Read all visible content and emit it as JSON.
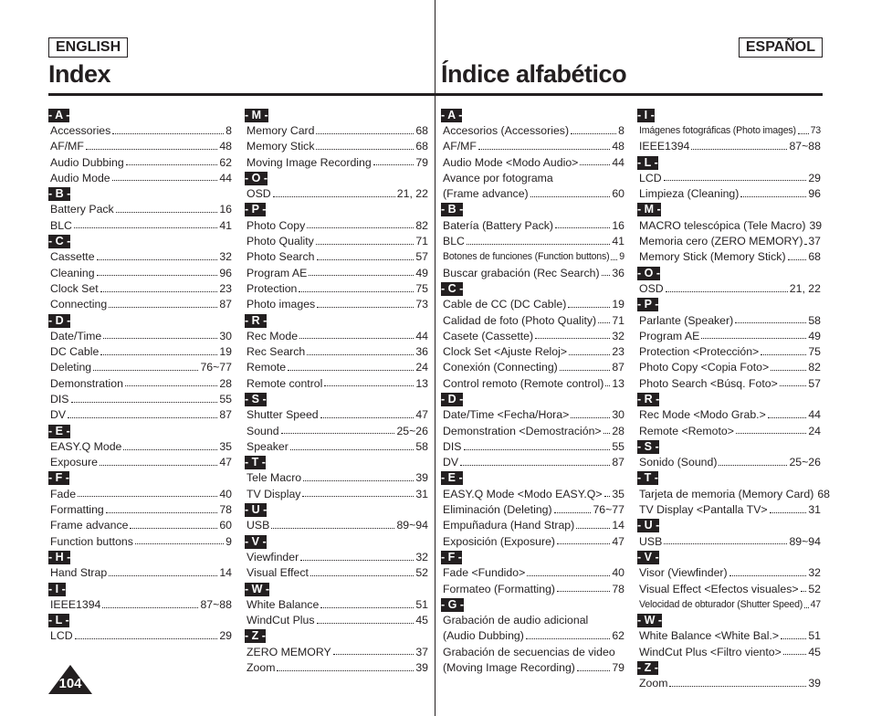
{
  "header": {
    "english_label": "ENGLISH",
    "spanish_label": "ESPAÑOL",
    "english_title": "Index",
    "spanish_title": "Índice alfabético"
  },
  "page_number": "104",
  "columns": [
    [
      {
        "letter": "- A -",
        "items": [
          {
            "label": "Accessories",
            "page": "8"
          },
          {
            "label": "AF/MF",
            "page": "48"
          },
          {
            "label": "Audio Dubbing",
            "page": "62"
          },
          {
            "label": "Audio Mode",
            "page": "44"
          }
        ]
      },
      {
        "letter": "- B -",
        "items": [
          {
            "label": "Battery Pack",
            "page": "16"
          },
          {
            "label": "BLC",
            "page": "41"
          }
        ]
      },
      {
        "letter": "- C -",
        "items": [
          {
            "label": "Cassette",
            "page": "32"
          },
          {
            "label": "Cleaning",
            "page": "96"
          },
          {
            "label": "Clock Set",
            "page": "23"
          },
          {
            "label": "Connecting",
            "page": "87"
          }
        ]
      },
      {
        "letter": "- D -",
        "items": [
          {
            "label": "Date/Time",
            "page": "30"
          },
          {
            "label": "DC Cable",
            "page": "19"
          },
          {
            "label": "Deleting",
            "page": "76~77"
          },
          {
            "label": "Demonstration",
            "page": "28"
          },
          {
            "label": "DIS",
            "page": "55"
          },
          {
            "label": "DV",
            "page": "87"
          }
        ]
      },
      {
        "letter": "- E -",
        "items": [
          {
            "label": "EASY.Q Mode",
            "page": "35"
          },
          {
            "label": "Exposure",
            "page": "47"
          }
        ]
      },
      {
        "letter": "- F -",
        "items": [
          {
            "label": "Fade",
            "page": "40"
          },
          {
            "label": "Formatting",
            "page": "78"
          },
          {
            "label": "Frame advance",
            "page": "60"
          },
          {
            "label": "Function buttons",
            "page": "9"
          }
        ]
      },
      {
        "letter": "- H -",
        "items": [
          {
            "label": "Hand Strap",
            "page": "14"
          }
        ]
      },
      {
        "letter": "- I -",
        "items": [
          {
            "label": "IEEE1394",
            "page": "87~88"
          }
        ]
      },
      {
        "letter": "- L -",
        "items": [
          {
            "label": "LCD",
            "page": "29"
          }
        ]
      }
    ],
    [
      {
        "letter": "- M -",
        "items": [
          {
            "label": "Memory Card",
            "page": "68"
          },
          {
            "label": "Memory Stick",
            "page": "68"
          },
          {
            "label": "Moving Image Recording",
            "page": "79"
          }
        ]
      },
      {
        "letter": "- O -",
        "items": [
          {
            "label": "OSD",
            "page": "21, 22"
          }
        ]
      },
      {
        "letter": "- P -",
        "items": [
          {
            "label": "Photo Copy",
            "page": "82"
          },
          {
            "label": "Photo Quality",
            "page": "71"
          },
          {
            "label": "Photo Search",
            "page": "57"
          },
          {
            "label": "Program AE",
            "page": "49"
          },
          {
            "label": "Protection",
            "page": "75"
          },
          {
            "label": "Photo images",
            "page": "73"
          }
        ]
      },
      {
        "letter": "- R -",
        "items": [
          {
            "label": "Rec Mode",
            "page": "44"
          },
          {
            "label": "Rec Search",
            "page": "36"
          },
          {
            "label": "Remote",
            "page": "24"
          },
          {
            "label": "Remote control",
            "page": "13"
          }
        ]
      },
      {
        "letter": "- S -",
        "items": [
          {
            "label": "Shutter Speed",
            "page": "47"
          },
          {
            "label": "Sound",
            "page": "25~26"
          },
          {
            "label": "Speaker",
            "page": "58"
          }
        ]
      },
      {
        "letter": "- T -",
        "items": [
          {
            "label": "Tele Macro",
            "page": "39"
          },
          {
            "label": "TV Display",
            "page": "31"
          }
        ]
      },
      {
        "letter": "- U -",
        "items": [
          {
            "label": "USB",
            "page": "89~94"
          }
        ]
      },
      {
        "letter": "- V -",
        "items": [
          {
            "label": "Viewfinder",
            "page": "32"
          },
          {
            "label": "Visual Effect",
            "page": "52"
          }
        ]
      },
      {
        "letter": "- W -",
        "items": [
          {
            "label": "White Balance",
            "page": "51"
          },
          {
            "label": "WindCut Plus",
            "page": "45"
          }
        ]
      },
      {
        "letter": "- Z -",
        "items": [
          {
            "label": "ZERO MEMORY",
            "page": "37"
          },
          {
            "label": "Zoom",
            "page": "39"
          }
        ]
      }
    ],
    [
      {
        "letter": "- A -",
        "items": [
          {
            "label": "Accesorios (Accessories)",
            "page": "8"
          },
          {
            "label": "AF/MF",
            "page": "48"
          },
          {
            "label": "Audio Mode <Modo Audio>",
            "page": "44"
          },
          {
            "pre": "Avance por fotograma",
            "label": "(Frame advance)",
            "page": "60"
          }
        ]
      },
      {
        "letter": "- B -",
        "items": [
          {
            "label": "Batería (Battery Pack)",
            "page": "16"
          },
          {
            "label": "BLC",
            "page": "41"
          },
          {
            "label": "Botones de funciones (Function buttons)",
            "page": "9"
          },
          {
            "label": "Buscar grabación (Rec Search)",
            "page": "36"
          }
        ]
      },
      {
        "letter": "- C -",
        "items": [
          {
            "label": "Cable de CC (DC Cable)",
            "page": "19"
          },
          {
            "label": "Calidad de foto (Photo Quality)",
            "page": "71"
          },
          {
            "label": "Casete (Cassette)",
            "page": "32"
          },
          {
            "label": "Clock Set <Ajuste Reloj>",
            "page": "23"
          },
          {
            "label": "Conexión (Connecting)",
            "page": "87"
          },
          {
            "label": "Control remoto (Remote control)",
            "page": "13"
          }
        ]
      },
      {
        "letter": "- D -",
        "items": [
          {
            "label": "Date/Time <Fecha/Hora>",
            "page": "30"
          },
          {
            "label": "Demonstration <Demostración>",
            "page": "28"
          },
          {
            "label": "DIS",
            "page": "55"
          },
          {
            "label": "DV",
            "page": "87"
          }
        ]
      },
      {
        "letter": "- E -",
        "items": [
          {
            "label": "EASY.Q Mode <Modo EASY.Q>",
            "page": "35"
          },
          {
            "label": "Eliminación (Deleting)",
            "page": "76~77"
          },
          {
            "label": "Empuñadura (Hand Strap)",
            "page": "14"
          },
          {
            "label": "Exposición (Exposure)",
            "page": "47"
          }
        ]
      },
      {
        "letter": "- F -",
        "items": [
          {
            "label": "Fade <Fundido>",
            "page": "40"
          },
          {
            "label": "Formateo (Formatting)",
            "page": "78"
          }
        ]
      },
      {
        "letter": "- G -",
        "items": [
          {
            "pre": "Grabación de audio adicional",
            "label": "(Audio Dubbing)",
            "page": "62"
          },
          {
            "pre": "Grabación de secuencias de video",
            "label": "(Moving Image Recording)",
            "page": "79"
          }
        ]
      }
    ],
    [
      {
        "letter": "- I -",
        "items": [
          {
            "label": "Imágenes fotográficas (Photo images)",
            "page": "73"
          },
          {
            "label": "IEEE1394",
            "page": "87~88"
          }
        ]
      },
      {
        "letter": "- L -",
        "items": [
          {
            "label": "LCD",
            "page": "29"
          },
          {
            "label": "Limpieza (Cleaning)",
            "page": "96"
          }
        ]
      },
      {
        "letter": "- M -",
        "items": [
          {
            "label": "MACRO telescópica (Tele Macro)",
            "page": "39"
          },
          {
            "label": "Memoria cero (ZERO MEMORY)",
            "page": "37"
          },
          {
            "label": "Memory Stick (Memory Stick)",
            "page": "68"
          }
        ]
      },
      {
        "letter": "- O -",
        "items": [
          {
            "label": "OSD",
            "page": "21, 22"
          }
        ]
      },
      {
        "letter": "- P -",
        "items": [
          {
            "label": "Parlante (Speaker)",
            "page": "58"
          },
          {
            "label": "Program AE",
            "page": "49"
          },
          {
            "label": "Protection <Protección>",
            "page": "75"
          },
          {
            "label": "Photo Copy <Copia Foto>",
            "page": "82"
          },
          {
            "label": "Photo Search <Búsq. Foto>",
            "page": "57"
          }
        ]
      },
      {
        "letter": "- R -",
        "items": [
          {
            "label": "Rec Mode <Modo Grab.>",
            "page": "44"
          },
          {
            "label": "Remote <Remoto>",
            "page": "24"
          }
        ]
      },
      {
        "letter": "- S -",
        "items": [
          {
            "label": "Sonido (Sound)",
            "page": "25~26"
          }
        ]
      },
      {
        "letter": "- T -",
        "items": [
          {
            "label": "Tarjeta de memoria (Memory Card)",
            "page": "68"
          },
          {
            "label": "TV Display <Pantalla TV>",
            "page": "31"
          }
        ]
      },
      {
        "letter": "- U -",
        "items": [
          {
            "label": "USB",
            "page": "89~94"
          }
        ]
      },
      {
        "letter": "- V -",
        "items": [
          {
            "label": "Visor (Viewfinder)",
            "page": "32"
          },
          {
            "label": "Visual Effect <Efectos visuales>",
            "page": "52"
          },
          {
            "label": "Velocidad de obturador (Shutter Speed)",
            "page": "47"
          }
        ]
      },
      {
        "letter": "- W -",
        "items": [
          {
            "label": "White Balance <White Bal.>",
            "page": "51"
          },
          {
            "label": "WindCut Plus <Filtro viento>",
            "page": "45"
          }
        ]
      },
      {
        "letter": "- Z -",
        "items": [
          {
            "label": "Zoom",
            "page": "39"
          }
        ]
      }
    ]
  ]
}
